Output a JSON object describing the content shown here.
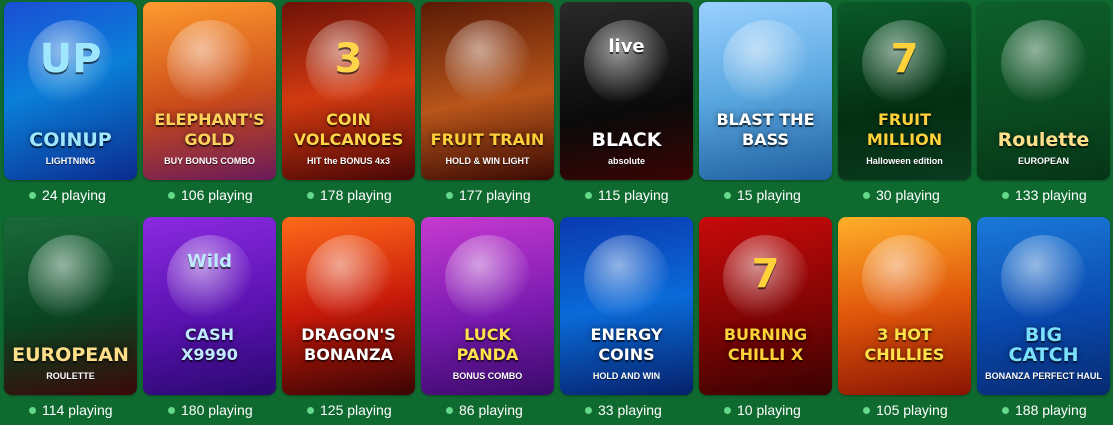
{
  "games": [
    {
      "title": "COINUP",
      "sub": "LIGHTNING",
      "extra": "UP",
      "players": "24 playing",
      "bg": "linear-gradient(160deg,#1b4fd6,#0a7fd8 45%,#0b2b8f)",
      "titleColor": "#9fe6ff",
      "icon": "coin-icon"
    },
    {
      "title": "ELEPHANT'S\nGOLD",
      "sub": "BUY BONUS COMBO",
      "players": "106 playing",
      "bg": "linear-gradient(170deg,#ff9a2e,#c94a1a 55%,#6a1a5a)",
      "titleColor": "#ffd35a",
      "icon": "elephant-icon"
    },
    {
      "title": "COIN\nVOLCANOES",
      "sub": "HIT the BONUS 4x3",
      "extra": "3",
      "players": "178 playing",
      "bg": "linear-gradient(170deg,#6e1208,#d23a10 50%,#4a0606)",
      "titleColor": "#ffd54a",
      "icon": "volcano-icon"
    },
    {
      "title": "FRUIT TRAIN",
      "sub": "HOLD & WIN LIGHT",
      "players": "177 playing",
      "bg": "linear-gradient(170deg,#5a1a06,#b8551a 55%,#3a0a04)",
      "titleColor": "#ffcf3a",
      "icon": "train-icon"
    },
    {
      "title": "BLACK",
      "sub": "absolute",
      "extra": "live",
      "players": "115 playing",
      "bg": "linear-gradient(170deg,#2a2a2a,#0a0a0a 60%,#3a0404)",
      "titleColor": "#ffffff",
      "icon": "roulette-wheel-icon"
    },
    {
      "title": "BLAST THE\nBASS",
      "sub": "",
      "players": "15 playing",
      "bg": "linear-gradient(170deg,#9ad0ff,#5aa7e0 50%,#1f5fa0)",
      "titleColor": "#ffffff",
      "icon": "fisherman-icon"
    },
    {
      "title": "FRUIT\nMILLION",
      "sub": "Halloween edition",
      "extra": "7",
      "players": "30 playing",
      "bg": "linear-gradient(170deg,#0a5a2a,#042f12 60%,#0a3a20)",
      "titleColor": "#ffd23a",
      "icon": "seven-icon"
    },
    {
      "title": "Roulette",
      "sub": "EUROPEAN",
      "players": "133 playing",
      "bg": "linear-gradient(170deg,#0d5f2a,#0a4a20 60%,#063517)",
      "titleColor": "#ffe08a",
      "icon": "roulette-wheel-icon"
    },
    {
      "title": "EUROPEAN",
      "sub": "ROULETTE",
      "players": "114 playing",
      "bg": "linear-gradient(170deg,#1a6a3a,#0a4422 55%,#3a0808)",
      "titleColor": "#ffe08a",
      "icon": "roulette-wheel-icon"
    },
    {
      "title": "CASH\nX9990",
      "sub": "",
      "extra": "Wild",
      "players": "180 playing",
      "bg": "linear-gradient(170deg,#8a2ae0,#5a12b0 55%,#2a0870)",
      "titleColor": "#bfe9ff",
      "icon": "fruit-icon"
    },
    {
      "title": "DRAGON'S\nBONANZA",
      "sub": "",
      "players": "125 playing",
      "bg": "linear-gradient(170deg,#ff6a1a,#c81a0a 50%,#3a0404)",
      "titleColor": "#ffffff",
      "icon": "dragon-icon"
    },
    {
      "title": "LUCK\nPANDA",
      "sub": "BONUS COMBO",
      "players": "86 playing",
      "bg": "linear-gradient(170deg,#c63ad0,#7a1ab0 55%,#3a0a6a)",
      "titleColor": "#ffe14a",
      "icon": "panda-icon"
    },
    {
      "title": "ENERGY\nCOINS",
      "sub": "HOLD AND WIN",
      "players": "33 playing",
      "bg": "linear-gradient(170deg,#0a3ab0,#0a6ad8 50%,#06206a)",
      "titleColor": "#ffffff",
      "icon": "lightning-coin-icon"
    },
    {
      "title": "BURNING\nCHILLI X",
      "sub": "",
      "extra": "7",
      "players": "10 playing",
      "bg": "linear-gradient(170deg,#c80a0a,#7a0404 60%,#3a0202)",
      "titleColor": "#ffd23a",
      "icon": "chilli-icon"
    },
    {
      "title": "3 HOT\nCHILLIES",
      "sub": "",
      "players": "105 playing",
      "bg": "linear-gradient(170deg,#ffb02a,#e0560a 50%,#8a1404)",
      "titleColor": "#ffe24a",
      "icon": "mariachi-icon"
    },
    {
      "title": "BIG\nCATCH",
      "sub": "BONANZA PERFECT HAUL",
      "players": "188 playing",
      "bg": "linear-gradient(170deg,#1a7ad8,#0a4ab0 55%,#062a70)",
      "titleColor": "#7ae0ff",
      "icon": "fisherman-icon"
    }
  ],
  "colors": {
    "page_bg": "#0f6a30",
    "dot": "#64d98a"
  }
}
